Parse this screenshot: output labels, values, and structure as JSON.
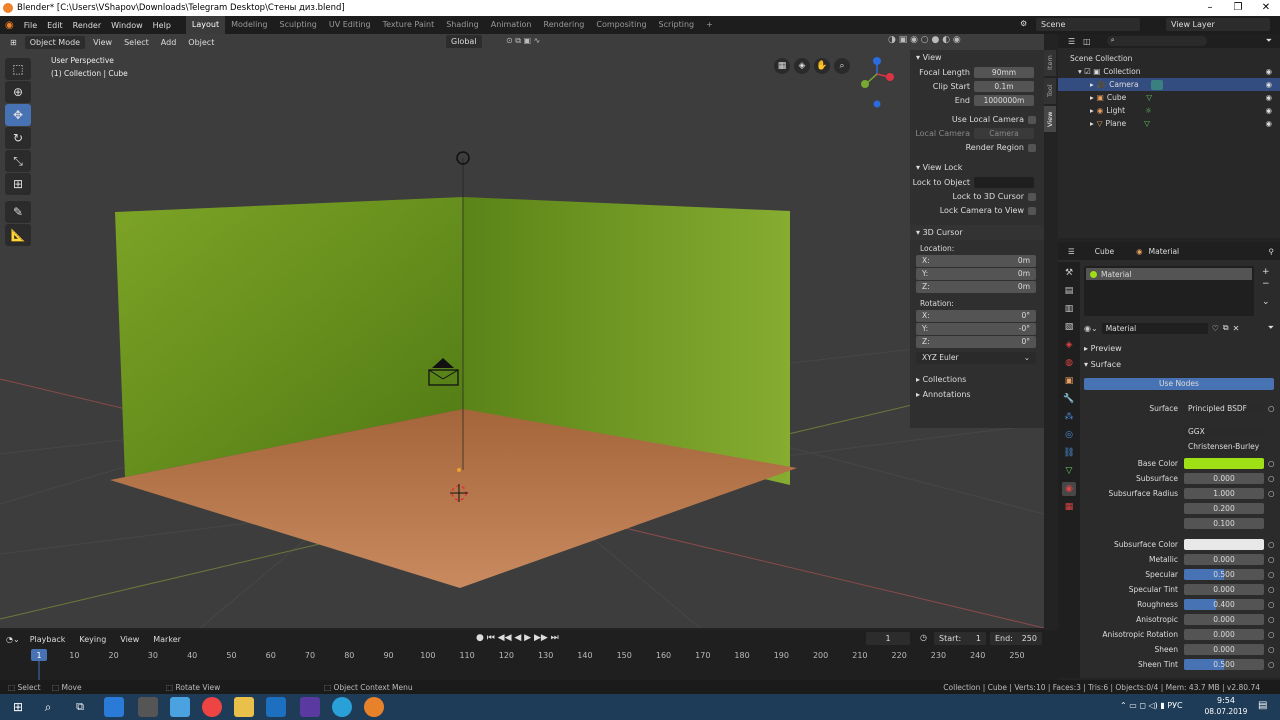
{
  "window": {
    "title": "Blender* [C:\\Users\\VShapov\\Downloads\\Telegram Desktop\\Стены диз.blend]"
  },
  "menus": [
    "File",
    "Edit",
    "Render",
    "Window",
    "Help"
  ],
  "workspaces": [
    "Layout",
    "Modeling",
    "Sculpting",
    "UV Editing",
    "Texture Paint",
    "Shading",
    "Animation",
    "Rendering",
    "Compositing",
    "Scripting"
  ],
  "scene": "Scene",
  "view_layer": "View Layer",
  "viewport": {
    "mode": "Object Mode",
    "menus": [
      "View",
      "Select",
      "Add",
      "Object"
    ],
    "transform": "Global",
    "perspective": "User Perspective",
    "collection": "(1) Collection | Cube"
  },
  "npanel": {
    "tabs": [
      "Item",
      "Tool",
      "View"
    ],
    "view_title": "View",
    "focal_label": "Focal Length",
    "focal": "90mm",
    "clip_start_label": "Clip Start",
    "clip_start": "0.1m",
    "end_label": "End",
    "end": "1000000m",
    "use_local_camera": "Use Local Camera",
    "local_camera": "Local Camera",
    "camera_value": "Camera",
    "render_region": "Render Region",
    "view_lock": "View Lock",
    "lock_to_object": "Lock to Object",
    "lock_3d_cursor": "Lock to 3D Cursor",
    "lock_camera": "Lock Camera to View",
    "cursor_title": "3D Cursor",
    "location": "Location:",
    "rotation": "Rotation:",
    "loc": [
      {
        "a": "X:",
        "v": "0m"
      },
      {
        "a": "Y:",
        "v": "0m"
      },
      {
        "a": "Z:",
        "v": "0m"
      }
    ],
    "rot": [
      {
        "a": "X:",
        "v": "0°"
      },
      {
        "a": "Y:",
        "v": "-0°"
      },
      {
        "a": "Z:",
        "v": "0°"
      }
    ],
    "rot_mode": "XYZ Euler",
    "collections": "Collections",
    "annotations": "Annotations"
  },
  "outliner": {
    "scene_collection": "Scene Collection",
    "collection": "Collection",
    "items": [
      "Camera",
      "Cube",
      "Light",
      "Plane"
    ]
  },
  "properties": {
    "object": "Cube",
    "material_tab": "Material",
    "slot": "Material",
    "material_name": "Material",
    "preview": "Preview",
    "surface": "Surface",
    "use_nodes": "Use Nodes",
    "surface_label": "Surface",
    "surface_value": "Principled BSDF",
    "distribution": "GGX",
    "subsurface_method": "Christensen-Burley",
    "base_color_label": "Base Color",
    "base_color": "#9ee015",
    "fields": [
      {
        "l": "Subsurface",
        "v": "0.000"
      },
      {
        "l": "Subsurface Radius",
        "v": "1.000"
      },
      {
        "l": "",
        "v": "0.200"
      },
      {
        "l": "",
        "v": "0.100"
      }
    ],
    "subsurface_color_label": "Subsurface Color",
    "subsurface_color": "#e8e8e8",
    "fields2": [
      {
        "l": "Metallic",
        "v": "0.000",
        "f": 0
      },
      {
        "l": "Specular",
        "v": "0.500",
        "f": 0.5
      },
      {
        "l": "Specular Tint",
        "v": "0.000",
        "f": 0
      },
      {
        "l": "Roughness",
        "v": "0.400",
        "f": 0.4
      },
      {
        "l": "Anisotropic",
        "v": "0.000",
        "f": 0
      },
      {
        "l": "Anisotropic Rotation",
        "v": "0.000",
        "f": 0
      },
      {
        "l": "Sheen",
        "v": "0.000",
        "f": 0
      },
      {
        "l": "Sheen Tint",
        "v": "0.500",
        "f": 0.5
      }
    ]
  },
  "timeline": {
    "menus": [
      "Playback",
      "Keying",
      "View",
      "Marker"
    ],
    "current": "1",
    "start_label": "Start:",
    "start": "1",
    "end_label": "End:",
    "end": "250",
    "ticks": [
      "1",
      "10",
      "20",
      "30",
      "40",
      "50",
      "60",
      "70",
      "80",
      "90",
      "100",
      "110",
      "120",
      "130",
      "140",
      "150",
      "160",
      "170",
      "180",
      "190",
      "200",
      "210",
      "220",
      "230",
      "240",
      "250"
    ]
  },
  "status": {
    "select": "Select",
    "move": "Move",
    "rotate": "Rotate View",
    "context": "Object Context Menu",
    "info": "Collection | Cube | Verts:10 | Faces:3 | Tris:6 | Objects:0/4 | Mem: 43.7 MB | v2.80.74"
  },
  "taskbar": {
    "time": "9:54",
    "date": "08.07.2019"
  }
}
